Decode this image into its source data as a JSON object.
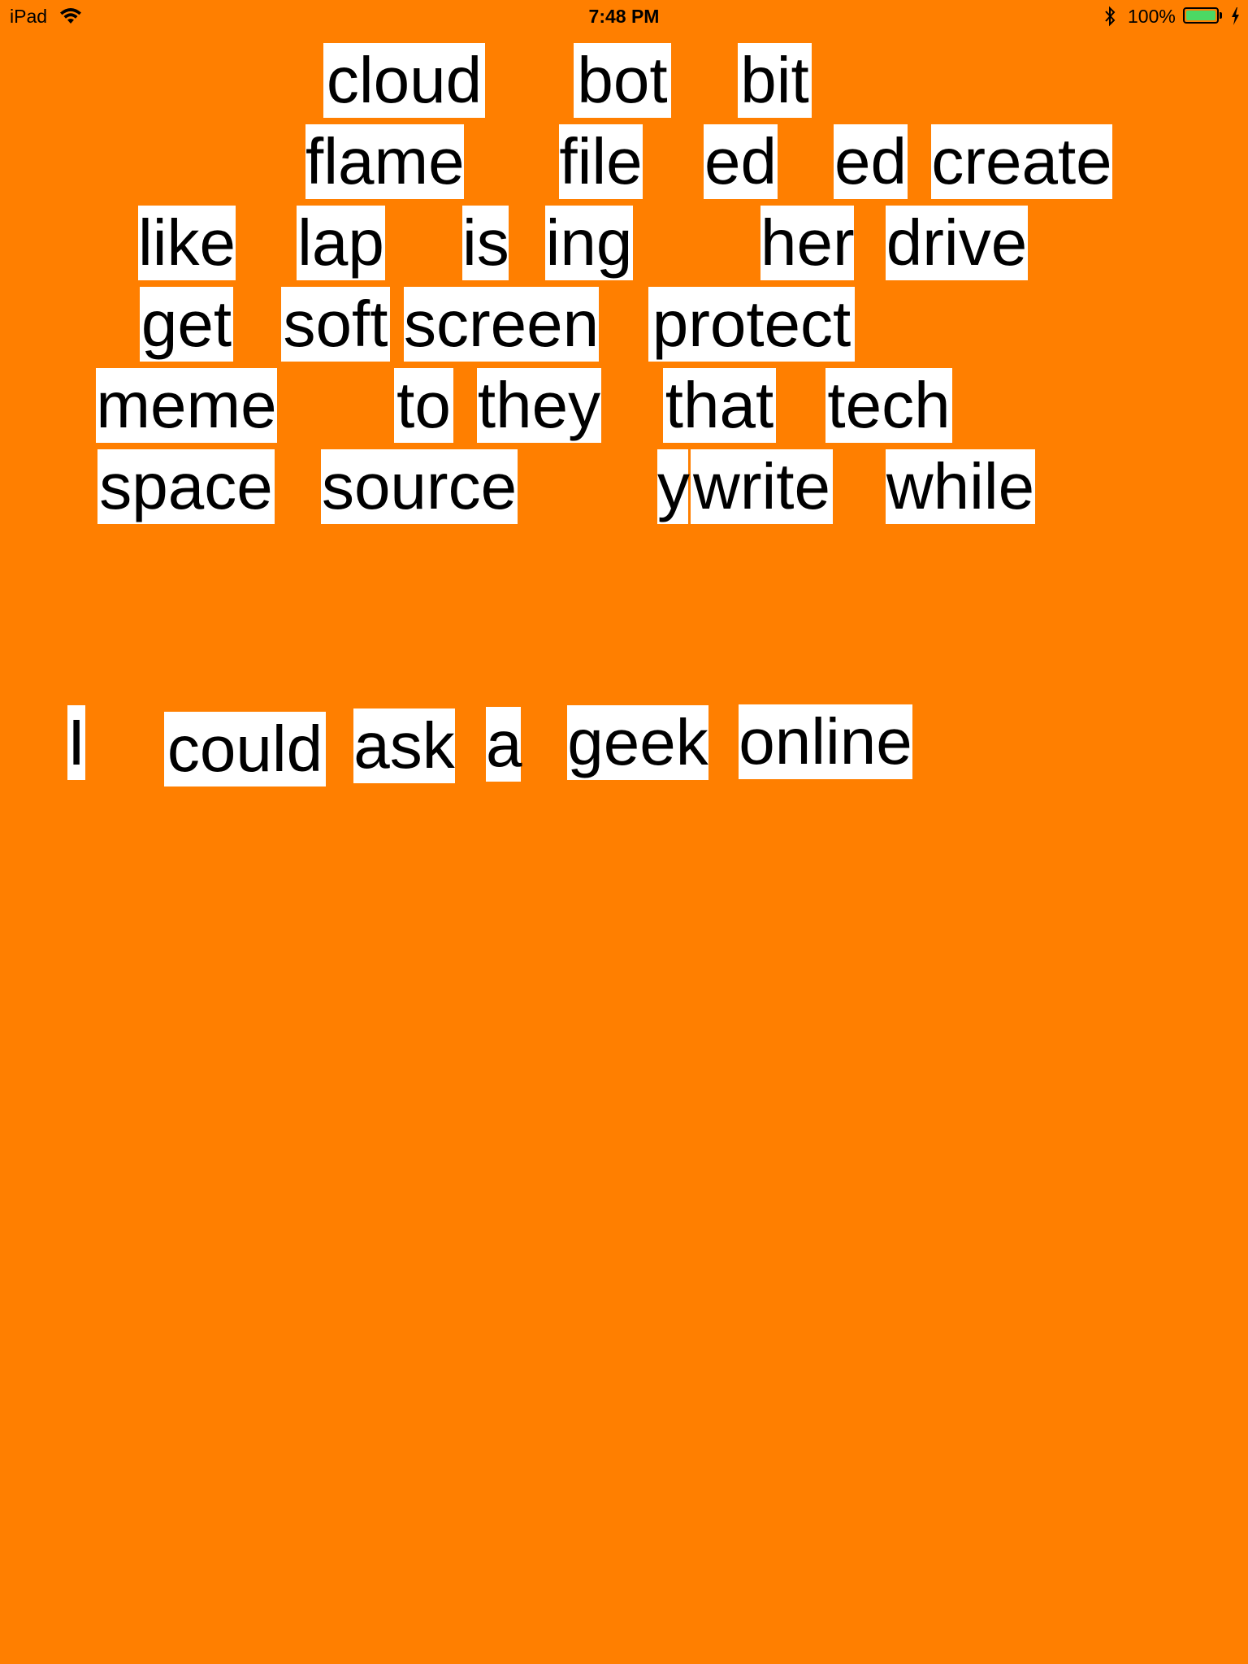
{
  "status_bar": {
    "device": "iPad",
    "time": "7:48 PM",
    "battery_percent": "100%",
    "battery_level": 1.0,
    "wifi_icon": "wifi-icon",
    "bluetooth_icon": "bluetooth-icon",
    "charging_icon": "charging-bolt-icon"
  },
  "colors": {
    "background": "#FF7F00",
    "tile": "#FFFFFF",
    "text": "#000000",
    "battery": "#4CD964"
  },
  "word_bank": {
    "row1": [
      "cloud",
      "bot",
      "bit"
    ],
    "row2": [
      "flame",
      "file",
      "ed",
      "ed",
      "create"
    ],
    "row3": [
      "like",
      "lap",
      "is",
      "ing",
      "her",
      "drive"
    ],
    "row4": [
      "get",
      "soft",
      "screen",
      "protect"
    ],
    "row5": [
      "meme",
      "to",
      "they",
      "that",
      "tech"
    ],
    "row6": [
      "space",
      "source",
      "y",
      "write",
      "while"
    ]
  },
  "sentence": [
    "I",
    "could",
    "ask",
    "a",
    "geek",
    "online"
  ]
}
